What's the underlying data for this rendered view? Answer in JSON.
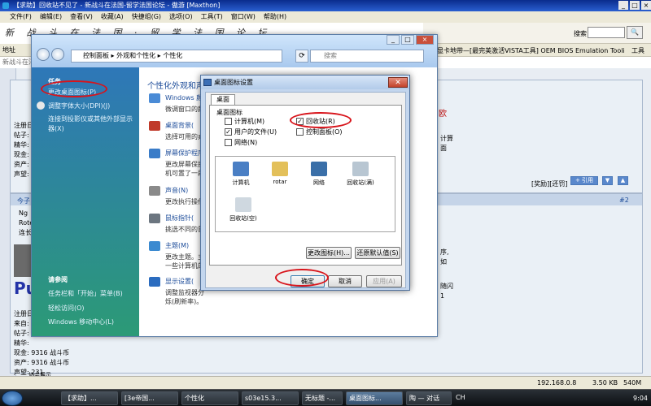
{
  "browser": {
    "title": "【求助】回收站不见了 - 新战斗在法国-留学法国论坛 - 傲游 [Maxthon]",
    "menu": [
      "文件(F)",
      "编辑(E)",
      "查看(V)",
      "收藏(A)",
      "快捷组(G)",
      "选项(O)",
      "工具(T)",
      "窗口(W)",
      "帮助(H)"
    ],
    "logo_text": "新 战 斗 在 法 国 · 留 学 法 国 论 坛",
    "search_label": "搜索",
    "search_go": "🔍",
    "address_label": "地址",
    "address_right": "显卡地带—[最完美激活VISTA工具] OEM BIOS Emulation Tooli",
    "tools_label": "工具",
    "info_bar": "新战斗在法国"
  },
  "forum": {
    "post1_lines": [
      "注册日",
      "帖子:",
      "精华:",
      "现金:",
      "资产:",
      "声望:"
    ],
    "post1_tail": "欧",
    "post1_right_lines": [
      "计算",
      "面"
    ],
    "reward_links": "[奖励][还罚]",
    "reply_btn": "+ 引用",
    "post_no": "#2",
    "post2_head": "今子",
    "post2_lines": [
      "Ng",
      "Rote",
      "连长"
    ],
    "signature": "Pu",
    "post2_info": [
      "注册日",
      "来自:",
      "帖子:",
      "精华:",
      "现金: 9316 战斗币",
      "资产: 9316 战斗币",
      "声望: 231"
    ],
    "post2_right": [
      "序,",
      "如"
    ],
    "post2_right2": [
      "随闪",
      "1"
    ],
    "bottom_link": "协会展示"
  },
  "explorer": {
    "breadcrumb": "控制面板 ▸ 外观和个性化 ▸ 个性化",
    "search_placeholder": "搜索",
    "sidebar_tasks_title": "任务",
    "sidebar_tasks": [
      "更改桌面图标(P)",
      "调整字体大小(DPI)(J)",
      "连接到投影仪或其他外部显示器(X)"
    ],
    "sidebar_see_title": "请参阅",
    "sidebar_see": [
      "任务栏和「开始」菜单(B)",
      "轻松访问(O)",
      "Windows 移动中心(L)"
    ],
    "heading": "个性化外观和声",
    "items": [
      {
        "link": "Windows 颜",
        "desc": [
          "微调窗口的颜"
        ]
      },
      {
        "link": "桌面背景(",
        "desc": [
          "选择可用的桌"
        ]
      },
      {
        "link": "屏幕保护程序",
        "desc": [
          "更改屏幕保护",
          "机可置了一段"
        ]
      },
      {
        "link": "声音(N)",
        "desc": [
          "更改执行操作"
        ]
      },
      {
        "link": "鼠标指针(",
        "desc": [
          "挑选不同的鼠"
        ]
      },
      {
        "link": "主题(M)",
        "desc": [
          "更改主题。主",
          "一些计算机的"
        ]
      },
      {
        "link": "显示设置(",
        "desc": [
          "调整监视器分",
          "烁(刷新率)。"
        ]
      }
    ]
  },
  "dialog": {
    "title": "桌面图标设置",
    "close": "✕",
    "tab": "桌面",
    "group_label": "桌面图标",
    "checkboxes": [
      {
        "label": "计算机(M)",
        "checked": ""
      },
      {
        "label": "回收站(R)",
        "checked": "✓"
      },
      {
        "label": "用户的文件(U)",
        "checked": "✓"
      },
      {
        "label": "控制面板(O)",
        "checked": ""
      },
      {
        "label": "网络(N)",
        "checked": ""
      }
    ],
    "icons": [
      "计算机",
      "rotar",
      "网络",
      "回收站(满)",
      "回收站(空)"
    ],
    "change_icon_btn": "更改图标(H)...",
    "restore_btn": "还原默认值(S)",
    "ok_btn": "确定",
    "cancel_btn": "取消",
    "apply_btn": "应用(A)"
  },
  "statusbar": {
    "ip": "192.168.0.8",
    "speed": "3.50 KB",
    "mem": "540M"
  },
  "taskbar": {
    "items": [
      "【求助】...",
      "[3e帝国...",
      "个性化",
      "s03e15.3...",
      "无标题 -...",
      "桌面图标...",
      "陶 — 对话"
    ],
    "lang": "CH",
    "clock": "9:04"
  },
  "colors": {
    "annotation": "#d8141b",
    "sidebar_top": "#2e77b8",
    "sidebar_bottom": "#2c9a76"
  }
}
